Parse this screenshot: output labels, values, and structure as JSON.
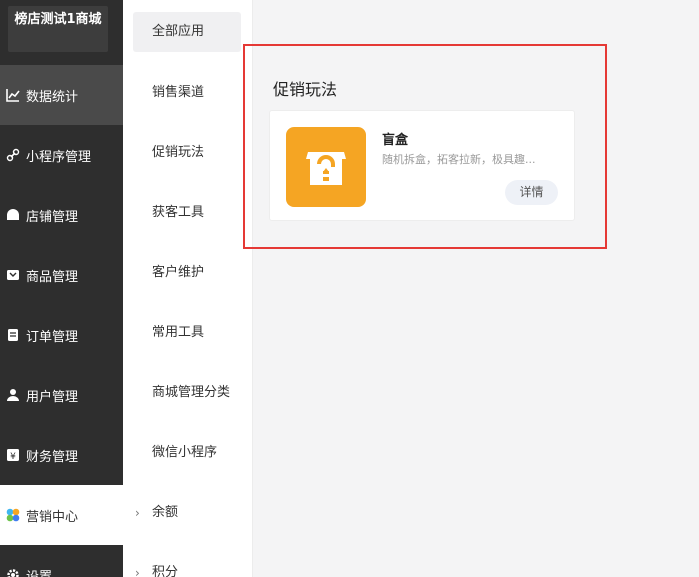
{
  "shop": {
    "title": "榜店测试1商城"
  },
  "sidebar": {
    "items": [
      {
        "label": "数据统计",
        "icon": "chart-icon"
      },
      {
        "label": "小程序管理",
        "icon": "link-icon"
      },
      {
        "label": "店铺管理",
        "icon": "store-icon"
      },
      {
        "label": "商品管理",
        "icon": "product-icon"
      },
      {
        "label": "订单管理",
        "icon": "order-icon"
      },
      {
        "label": "用户管理",
        "icon": "user-icon"
      },
      {
        "label": "财务管理",
        "icon": "yen-icon"
      },
      {
        "label": "营销中心",
        "icon": "marketing-icon"
      },
      {
        "label": "设置",
        "icon": "gear-icon"
      }
    ]
  },
  "submenu": {
    "items": [
      {
        "label": "全部应用"
      },
      {
        "label": "销售渠道"
      },
      {
        "label": "促销玩法"
      },
      {
        "label": "获客工具"
      },
      {
        "label": "客户维护"
      },
      {
        "label": "常用工具"
      },
      {
        "label": "商城管理分类"
      },
      {
        "label": "微信小程序"
      },
      {
        "label": "余额"
      },
      {
        "label": "积分"
      }
    ]
  },
  "main": {
    "section_title": "促销玩法",
    "card": {
      "title": "盲盒",
      "description": "随机拆盒，拓客拉新，极具趣...",
      "button": "详情"
    }
  },
  "colors": {
    "highlight": "#e53935",
    "card_icon": "#f5a523",
    "sidebar": "#2e2e2e"
  }
}
